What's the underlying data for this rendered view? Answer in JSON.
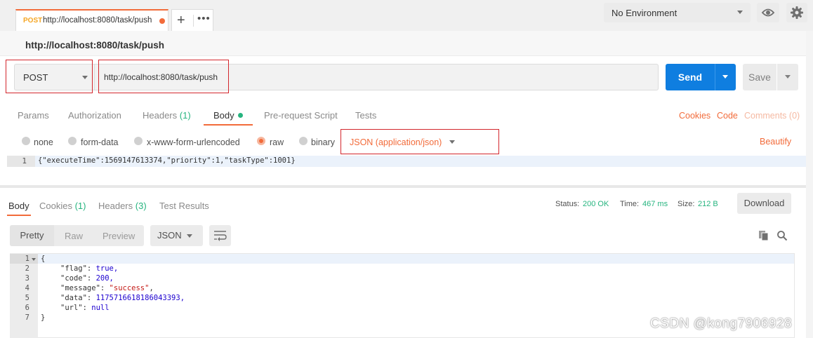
{
  "tab": {
    "method": "POST",
    "url": "http://localhost:8080/task/push"
  },
  "tab_tools": {
    "add": "+",
    "more": "•••"
  },
  "environment": {
    "selected": "No Environment"
  },
  "request": {
    "title": "http://localhost:8080/task/push",
    "method": "POST",
    "url": "http://localhost:8080/task/push",
    "send_label": "Send",
    "save_label": "Save"
  },
  "request_tabs": {
    "params": "Params",
    "authorization": "Authorization",
    "headers": "Headers",
    "headers_count": "(1)",
    "body": "Body",
    "prerequest": "Pre-request Script",
    "tests": "Tests",
    "cookies": "Cookies",
    "code": "Code",
    "comments": "Comments (0)"
  },
  "body_types": {
    "none": "none",
    "form_data": "form-data",
    "urlencoded": "x-www-form-urlencoded",
    "raw": "raw",
    "binary": "binary",
    "content_type": "JSON (application/json)",
    "beautify": "Beautify"
  },
  "request_body": {
    "line_no": "1",
    "code": "{\"executeTime\":1569147613374,\"priority\":1,\"taskType\":1001}"
  },
  "response_tabs": {
    "body": "Body",
    "cookies": "Cookies",
    "cookies_count": "(1)",
    "headers": "Headers",
    "headers_count": "(3)",
    "test_results": "Test Results"
  },
  "status": {
    "status_label": "Status:",
    "status_value": "200 OK",
    "time_label": "Time:",
    "time_value": "467 ms",
    "size_label": "Size:",
    "size_value": "212 B",
    "download": "Download"
  },
  "response_toolbar": {
    "pretty": "Pretty",
    "raw": "Raw",
    "preview": "Preview",
    "language": "JSON"
  },
  "response_body": {
    "line_numbers": [
      "1",
      "2",
      "3",
      "4",
      "5",
      "6",
      "7"
    ],
    "open_brace": "{",
    "close_brace": "}",
    "flag_key": "\"flag\":",
    "flag_value": "true,",
    "code_key": "\"code\":",
    "code_value": "200,",
    "message_key": "\"message\":",
    "message_value": "\"success\"",
    "data_key": "\"data\":",
    "data_value": "1175716618186043393,",
    "url_key": "\"url\":",
    "url_value": "null",
    "comma": ","
  },
  "watermark": "CSDN @kong7906928",
  "colors": {
    "accent": "#f26b3a",
    "send": "#0f7ee0",
    "success": "#26b47f",
    "highlight_box": "#d3262c"
  }
}
